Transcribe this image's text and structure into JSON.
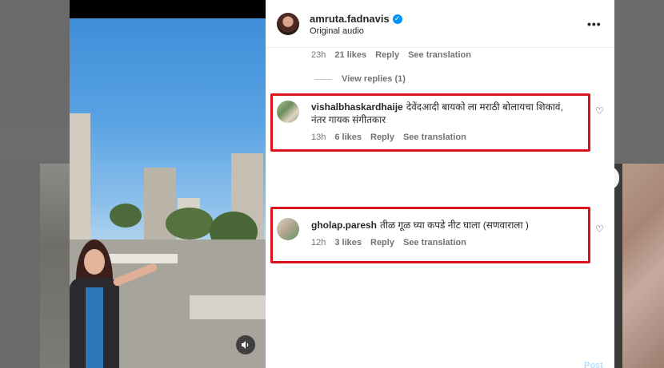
{
  "post": {
    "owner": "amruta.fadnavis",
    "audio": "Original audio",
    "more_label": "•••"
  },
  "previous_comment": {
    "time": "23h",
    "likes": "21 likes",
    "reply_label": "Reply",
    "translation_label": "See translation",
    "view_replies": "View replies (1)"
  },
  "comments": [
    {
      "username": "vishalbhaskardhaije",
      "text_line1": "देवेंदआदी बायको ला मराठी बोलायचा शिकावं,",
      "text_line2": "नंतर गायक संगीतकार",
      "time": "13h",
      "likes": "6 likes",
      "reply_label": "Reply",
      "translation_label": "See translation"
    },
    {
      "username": "gholap.paresh",
      "text_line1": "तीळ गूळ घ्या कपडे नीट घाला (सणवाराला )",
      "time": "12h",
      "likes": "3 likes",
      "reply_label": "Reply",
      "translation_label": "See translation"
    }
  ],
  "composer": {
    "post_label": "Post"
  },
  "colors": {
    "highlight": "#d9121b",
    "verified": "#0095f6"
  },
  "icons": {
    "verified": "verified-badge-icon",
    "like": "heart-icon",
    "mute": "speaker-icon",
    "more": "more-options-icon"
  }
}
